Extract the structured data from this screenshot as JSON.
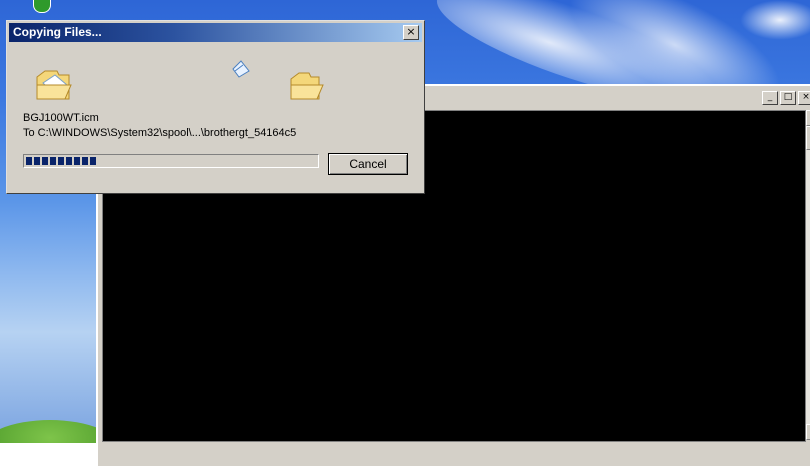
{
  "dialog": {
    "title": "Copying Files...",
    "close_glyph": "×",
    "file_name": "BGJ100WT.icm",
    "destination": "To C:\\WINDOWS\\System32\\spool\\...\\brothergt_54164c5",
    "progress_fraction": 0.25,
    "cancel_label": "Cancel",
    "icons": [
      "source-folder-icon",
      "flying-document-icon",
      "destination-folder-icon"
    ]
  },
  "background_window": {
    "buttons": [
      "_",
      "□",
      "×"
    ]
  },
  "colors": {
    "title_gradient_start": "#0a246a",
    "title_gradient_end": "#a6caf0",
    "dialog_face": "#d4d0c8",
    "console_bg": "#000000"
  }
}
